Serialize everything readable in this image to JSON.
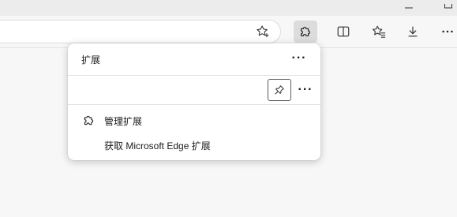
{
  "toolbar": {
    "favorite_icon": "star-add-icon",
    "extensions_icon": "puzzle-icon",
    "split_icon": "split-screen-icon",
    "favorites_icon": "favorites-icon",
    "downloads_icon": "download-icon",
    "more_icon": "more-icon",
    "more_label": "···"
  },
  "popup": {
    "title": "扩展",
    "more_label": "···",
    "pin_icon": "pin-icon",
    "row_more_label": "···",
    "items": [
      {
        "label": "管理扩展",
        "icon": "puzzle-icon"
      },
      {
        "label": "获取 Microsoft Edge 扩展",
        "icon": ""
      }
    ]
  },
  "colors": {
    "background": "#f7f7f7",
    "popup": "#ffffff",
    "active_button": "#dcdcdc",
    "divider": "#e2e2e2"
  }
}
